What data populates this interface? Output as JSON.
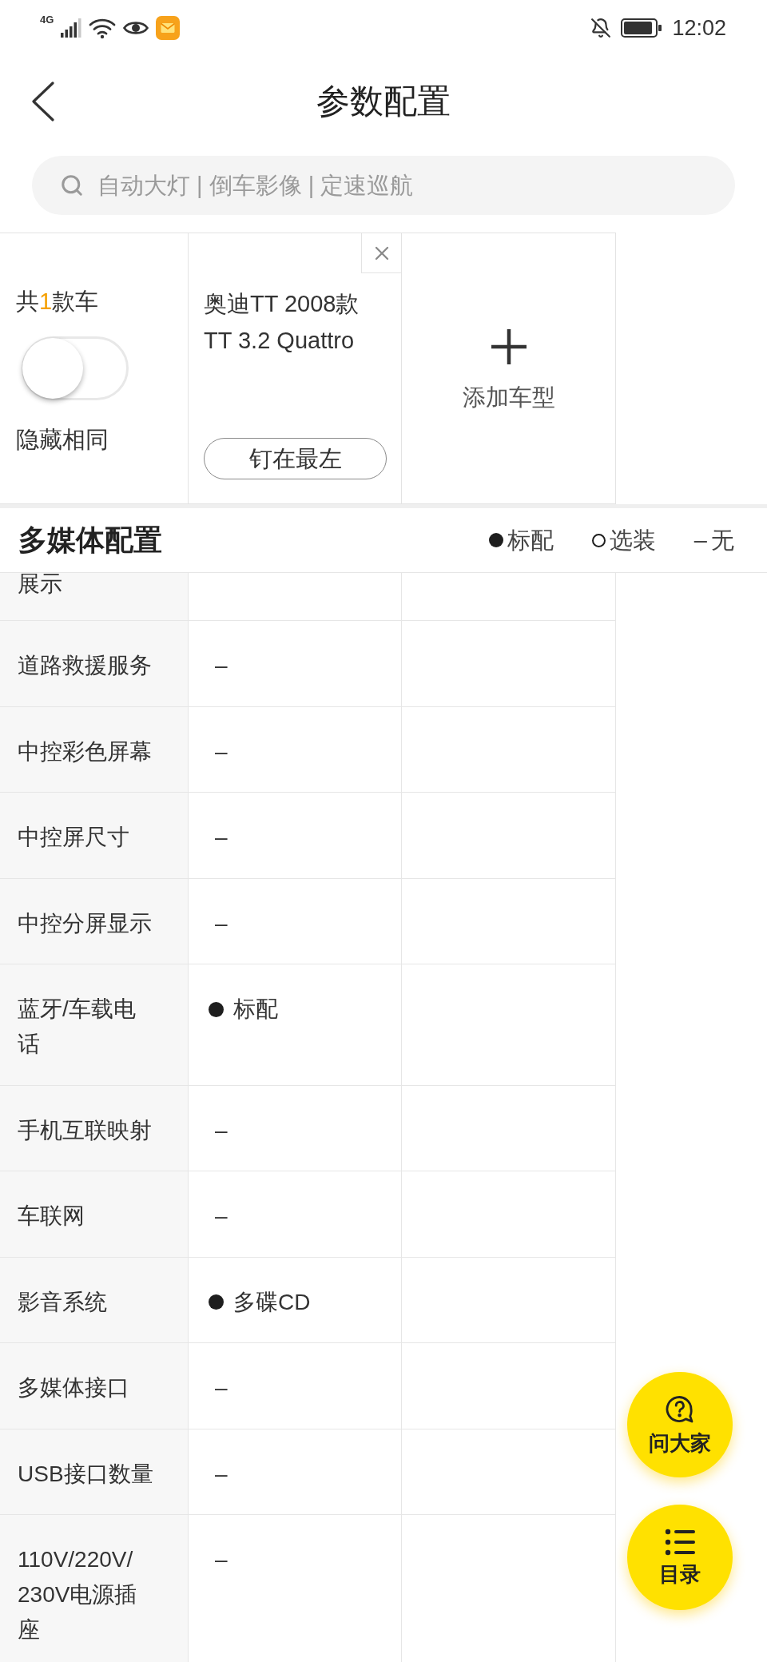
{
  "status_bar": {
    "network": "4G",
    "time": "12:02"
  },
  "header": {
    "title": "参数配置"
  },
  "search": {
    "placeholder": "自动大灯 | 倒车影像 | 定速巡航"
  },
  "car_panel": {
    "summary": {
      "before": "共",
      "count": "1",
      "after": "款车"
    },
    "hide_same": {
      "label": "隐藏相同",
      "on": false
    },
    "cars": [
      {
        "name": "奥迪TT 2008款 TT 3.2 Quattro",
        "pin_label": "钉在最左"
      }
    ],
    "add_label": "添加车型"
  },
  "section": {
    "title": "多媒体配置",
    "legend": [
      {
        "kind": "standard",
        "label": "标配"
      },
      {
        "kind": "optional",
        "label": "选装"
      },
      {
        "kind": "none",
        "symbol": "–",
        "label": "无"
      }
    ]
  },
  "rows": [
    {
      "label": "展示"
    },
    {
      "label": "道路救援服务",
      "values": [
        {
          "kind": "none",
          "text": "–"
        }
      ]
    },
    {
      "label": "中控彩色屏幕",
      "values": [
        {
          "kind": "none",
          "text": "–"
        }
      ]
    },
    {
      "label": "中控屏尺寸",
      "values": [
        {
          "kind": "none",
          "text": "–"
        }
      ]
    },
    {
      "label": "中控分屏显示",
      "values": [
        {
          "kind": "none",
          "text": "–"
        }
      ]
    },
    {
      "label": "蓝牙/车载电话",
      "values": [
        {
          "kind": "standard",
          "text": "标配"
        }
      ]
    },
    {
      "label": "手机互联映射",
      "values": [
        {
          "kind": "none",
          "text": "–"
        }
      ]
    },
    {
      "label": "车联网",
      "values": [
        {
          "kind": "none",
          "text": "–"
        }
      ]
    },
    {
      "label": "影音系统",
      "values": [
        {
          "kind": "standard",
          "text": "多碟CD"
        }
      ]
    },
    {
      "label": "多媒体接口",
      "values": [
        {
          "kind": "none",
          "text": "–"
        }
      ]
    },
    {
      "label": "USB接口数量",
      "values": [
        {
          "kind": "none",
          "text": "–"
        }
      ]
    },
    {
      "label": "110V/220V/230V电源插座",
      "values": [
        {
          "kind": "none",
          "text": "–"
        }
      ]
    }
  ],
  "fab": [
    {
      "kind": "ask",
      "label": "问大家"
    },
    {
      "kind": "catalog",
      "label": "目录"
    }
  ]
}
